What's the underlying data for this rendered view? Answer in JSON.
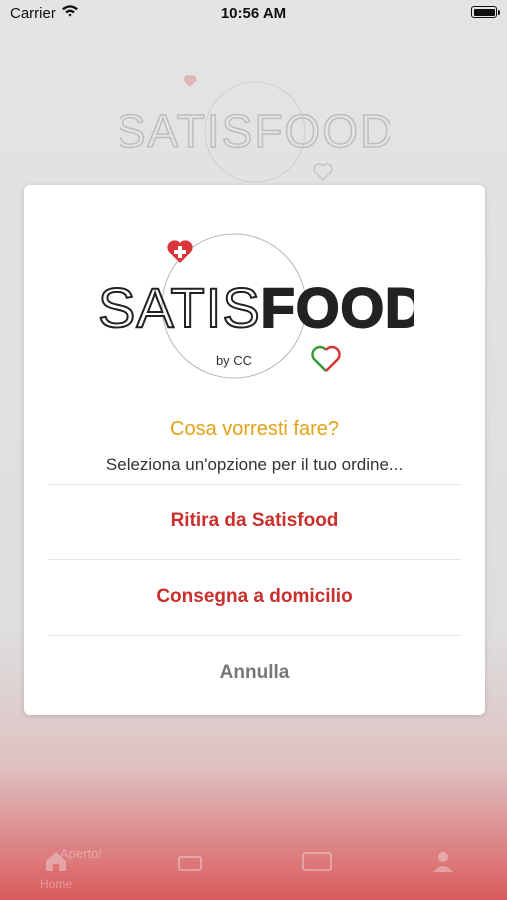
{
  "status_bar": {
    "carrier": "Carrier",
    "time": "10:56 AM"
  },
  "logo": {
    "brand_light": "SATIS",
    "brand_bold": "FOOD",
    "tagline": "by CC"
  },
  "dialog": {
    "title": "Cosa vorresti fare?",
    "message": "Seleziona un'opzione per il tuo ordine...",
    "actions": [
      {
        "label": "Ritira da Satisfood"
      },
      {
        "label": "Consegna a domicilio"
      }
    ],
    "cancel_label": "Annulla"
  },
  "tab_bar": {
    "badge": "Aperto!",
    "home_label": "Home"
  },
  "colors": {
    "title": "#e3a214",
    "action": "#c9302c",
    "cancel": "#777777",
    "heart": "#d9353b"
  }
}
